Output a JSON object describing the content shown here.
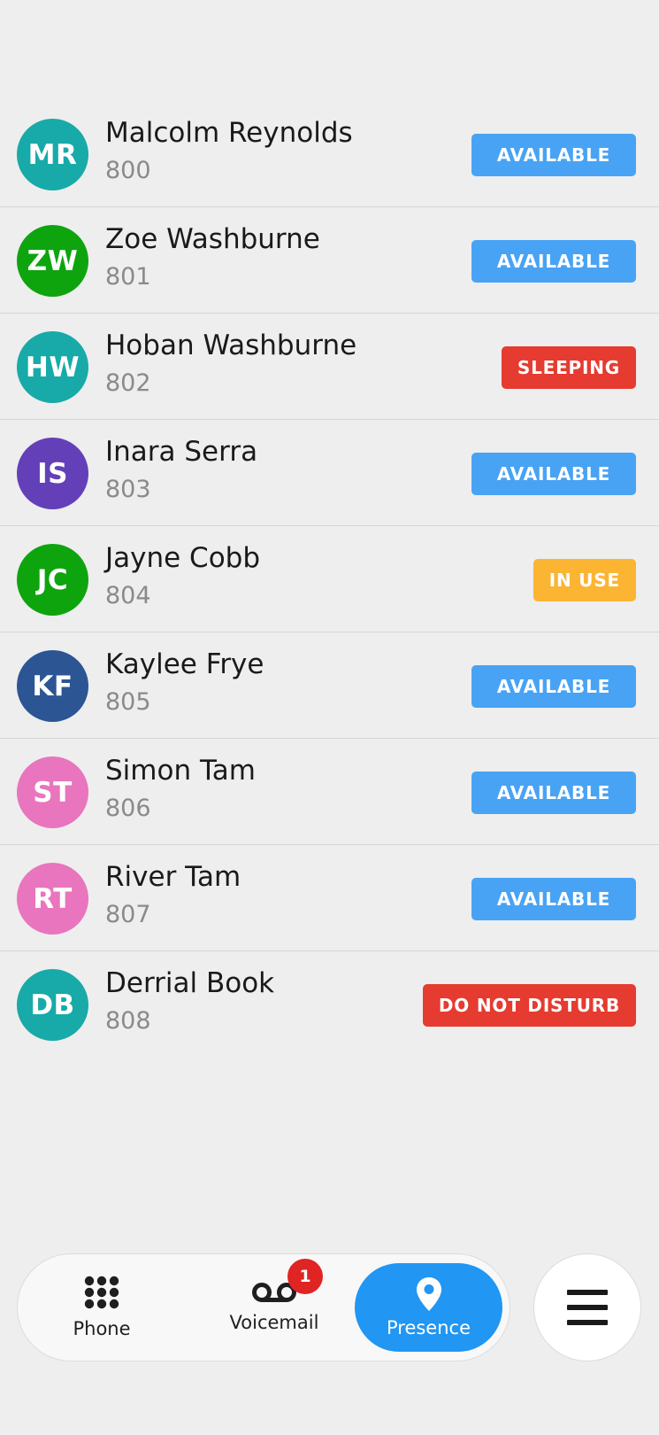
{
  "contacts": [
    {
      "initials": "MR",
      "name": "Malcolm Reynolds",
      "extension": "800",
      "status": "AVAILABLE",
      "avatar_color": "#17aaa8",
      "status_color": "#48a3f5"
    },
    {
      "initials": "ZW",
      "name": "Zoe Washburne",
      "extension": "801",
      "status": "AVAILABLE",
      "avatar_color": "#0ea40e",
      "status_color": "#48a3f5"
    },
    {
      "initials": "HW",
      "name": "Hoban Washburne",
      "extension": "802",
      "status": "SLEEPING",
      "avatar_color": "#17aaa8",
      "status_color": "#e53b30"
    },
    {
      "initials": "IS",
      "name": "Inara Serra",
      "extension": "803",
      "status": "AVAILABLE",
      "avatar_color": "#6340b8",
      "status_color": "#48a3f5"
    },
    {
      "initials": "JC",
      "name": "Jayne Cobb",
      "extension": "804",
      "status": "IN USE",
      "avatar_color": "#0ea40e",
      "status_color": "#fbb532"
    },
    {
      "initials": "KF",
      "name": "Kaylee Frye",
      "extension": "805",
      "status": "AVAILABLE",
      "avatar_color": "#2c5594",
      "status_color": "#48a3f5"
    },
    {
      "initials": "ST",
      "name": "Simon Tam",
      "extension": "806",
      "status": "AVAILABLE",
      "avatar_color": "#e875bd",
      "status_color": "#48a3f5"
    },
    {
      "initials": "RT",
      "name": "River Tam",
      "extension": "807",
      "status": "AVAILABLE",
      "avatar_color": "#e875bd",
      "status_color": "#48a3f5"
    },
    {
      "initials": "DB",
      "name": "Derrial Book",
      "extension": "808",
      "status": "DO NOT DISTURB",
      "avatar_color": "#17aaa8",
      "status_color": "#e53b30"
    }
  ],
  "nav": {
    "phone_label": "Phone",
    "phone_icon": "dialpad-icon",
    "voicemail_label": "Voicemail",
    "voicemail_icon": "voicemail-icon",
    "voicemail_badge": "1",
    "presence_label": "Presence",
    "presence_icon": "location-pin-icon",
    "active_tab": "Presence",
    "active_color": "#2196f3",
    "badge_color": "#e02424"
  },
  "menu": {
    "icon": "hamburger-menu-icon"
  }
}
